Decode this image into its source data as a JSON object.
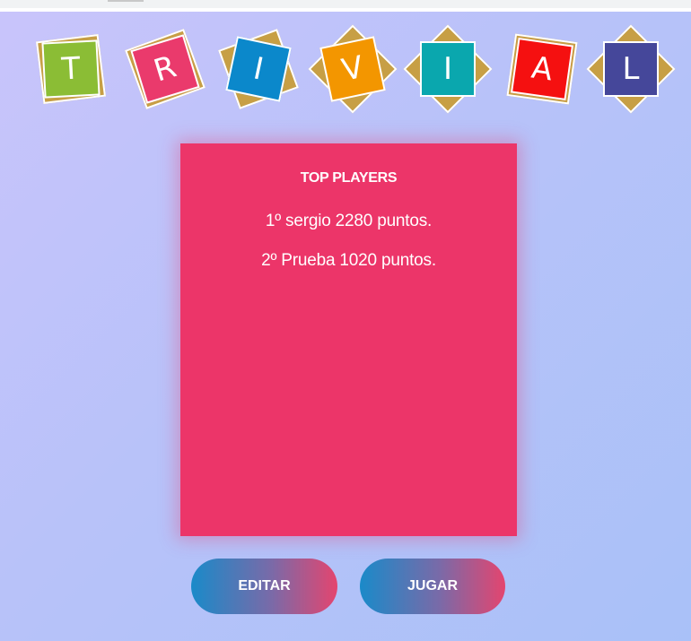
{
  "title_letters": [
    {
      "letter": "T",
      "color": "#8bbd35"
    },
    {
      "letter": "R",
      "color": "#ea3a6c"
    },
    {
      "letter": "I",
      "color": "#0b88cb"
    },
    {
      "letter": "V",
      "color": "#f39600"
    },
    {
      "letter": "I",
      "color": "#0aa7ae"
    },
    {
      "letter": "A",
      "color": "#f51010"
    },
    {
      "letter": "L",
      "color": "#45479a"
    }
  ],
  "ranking": {
    "title": "TOP PLAYERS",
    "players": [
      "1º sergio 2280 puntos.",
      "2º Prueba 1020 puntos."
    ]
  },
  "buttons": {
    "edit_label": "EDITAR",
    "play_label": "JUGAR"
  },
  "colors": {
    "panel": "#ec3569",
    "tile_back": "#c79f45"
  }
}
